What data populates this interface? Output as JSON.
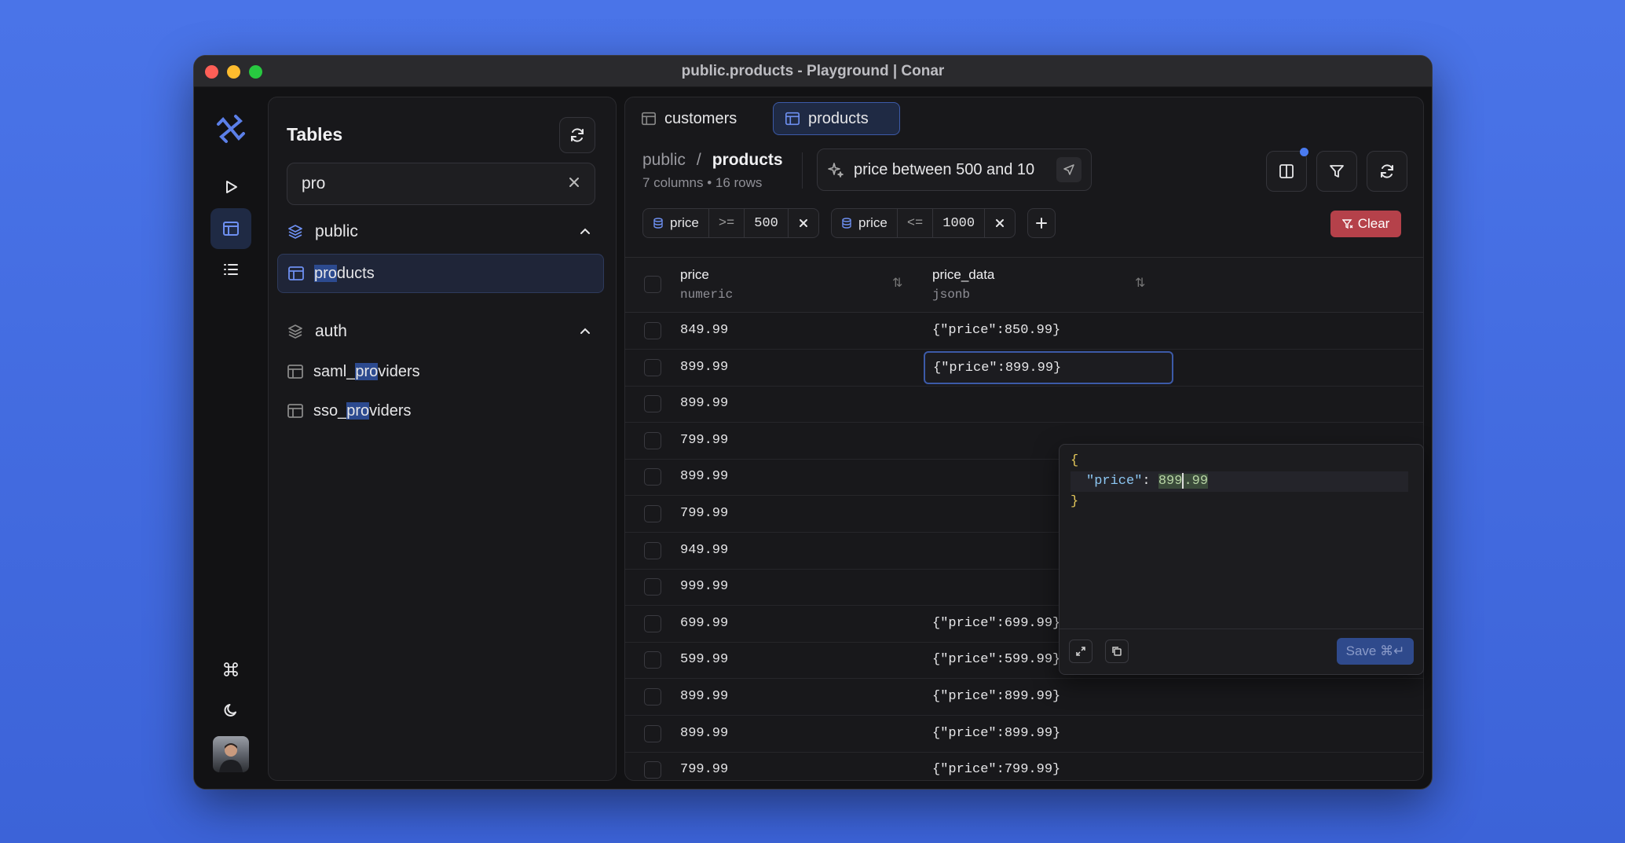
{
  "window": {
    "title": "public.products - Playground | Conar"
  },
  "sidebar": {
    "title": "Tables",
    "search_value": "pro",
    "schemas": [
      {
        "name": "public",
        "tables": [
          {
            "pre": "",
            "match": "pro",
            "post": "ducts"
          }
        ]
      },
      {
        "name": "auth",
        "tables": [
          {
            "pre": "saml_",
            "match": "pro",
            "post": "viders"
          },
          {
            "pre": "sso_",
            "match": "pro",
            "post": "viders"
          }
        ]
      }
    ]
  },
  "tabs": [
    {
      "label": "customers"
    },
    {
      "label": "products"
    }
  ],
  "breadcrumb": {
    "schema": "public",
    "sep": "/",
    "table": "products",
    "meta": "7 columns • 16 rows"
  },
  "ai_query": "price between 500 and 10",
  "filters": [
    {
      "column": "price",
      "op": ">=",
      "value": "500"
    },
    {
      "column": "price",
      "op": "<=",
      "value": "1000"
    }
  ],
  "clear_label": "Clear",
  "columns": [
    {
      "name": "price",
      "type": "numeric"
    },
    {
      "name": "price_data",
      "type": "jsonb"
    }
  ],
  "rows": [
    {
      "price": "849.99",
      "price_data": "{\"price\":850.99}"
    },
    {
      "price": "899.99",
      "price_data": "{\"price\":899.99}"
    },
    {
      "price": "899.99",
      "price_data": ""
    },
    {
      "price": "799.99",
      "price_data": ""
    },
    {
      "price": "899.99",
      "price_data": ""
    },
    {
      "price": "799.99",
      "price_data": ""
    },
    {
      "price": "949.99",
      "price_data": ""
    },
    {
      "price": "999.99",
      "price_data": ""
    },
    {
      "price": "699.99",
      "price_data": "{\"price\":699.99}"
    },
    {
      "price": "599.99",
      "price_data": "{\"price\":599.99}"
    },
    {
      "price": "899.99",
      "price_data": "{\"price\":899.99}"
    },
    {
      "price": "899.99",
      "price_data": "{\"price\":899.99}"
    },
    {
      "price": "799.99",
      "price_data": "{\"price\":799.99}"
    }
  ],
  "editor": {
    "open": "{",
    "key": "\"price\"",
    "colon": ": ",
    "val_a": "899",
    "val_b": ".99",
    "close": "}",
    "save_label": "Save ⌘↵"
  }
}
